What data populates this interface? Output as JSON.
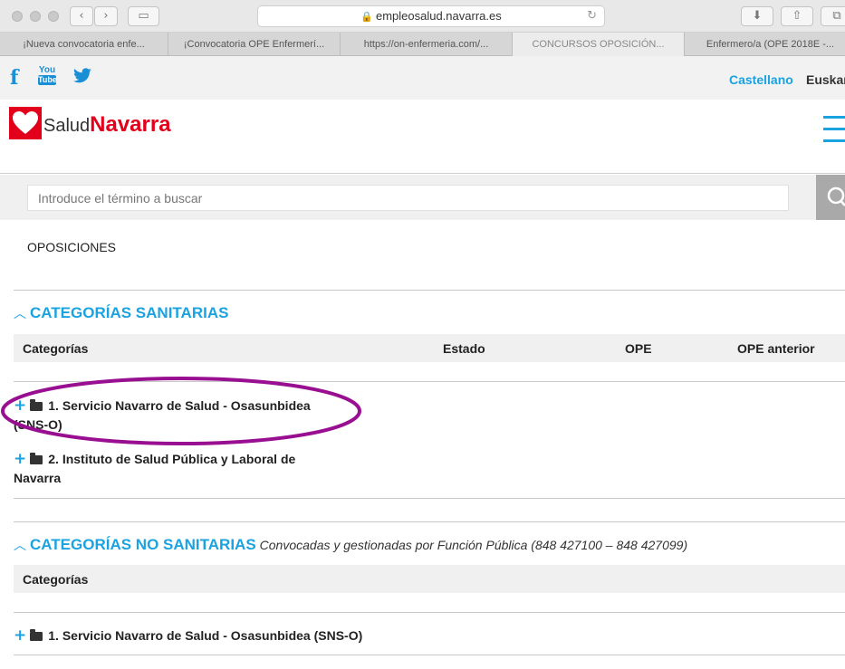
{
  "browser": {
    "url": "empleosalud.navarra.es",
    "tabs": [
      {
        "label": "¡Nueva convocatoria enfe..."
      },
      {
        "label": "¡Convocatoria OPE Enfermerí..."
      },
      {
        "label": "https://on-enfermeria.com/..."
      },
      {
        "label": "CONCURSOS OPOSICIÓN..."
      },
      {
        "label": "Enfermero/a (OPE 2018E -..."
      }
    ]
  },
  "social": {
    "facebook": "f",
    "youtube_top": "You",
    "youtube_bottom": "Tube",
    "languages": [
      "Castellano",
      "Euskara"
    ]
  },
  "logo": {
    "part1": "Salud",
    "part2": "Navarra"
  },
  "search": {
    "placeholder": "Introduce el término a buscar"
  },
  "page_title": "OPOSICIONES",
  "sanitarias": {
    "title": "CATEGORÍAS SANITARIAS",
    "columns": [
      "Categorías",
      "Estado",
      "OPE",
      "OPE anterior"
    ],
    "items": [
      {
        "line1": "1. Servicio Navarro de Salud - Osasunbidea",
        "line2": "(SNS-O)"
      },
      {
        "line1": "2. Instituto de Salud Pública y Laboral de",
        "line2": "Navarra"
      }
    ]
  },
  "no_sanitarias": {
    "title": "CATEGORÍAS NO SANITARIAS",
    "note": "Convocadas y gestionadas por Función Pública (848 427100 – 848 427099)",
    "columns": [
      "Categorías"
    ],
    "items": [
      {
        "line1": "1. Servicio Navarro de Salud - Osasunbidea (SNS-O)"
      }
    ]
  },
  "colors": {
    "accent": "#1aa3e0",
    "brand": "#e2001a",
    "annotation": "#990f91"
  }
}
